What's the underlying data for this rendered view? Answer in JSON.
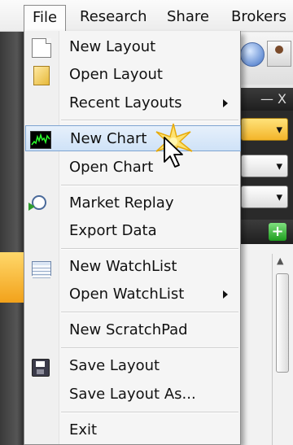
{
  "menubar": {
    "items": [
      "File",
      "Research",
      "Share",
      "Brokers"
    ]
  },
  "background": {
    "title_controls": "— X",
    "dropdown_caret": "▾",
    "add_icon_label": "+"
  },
  "file_menu": {
    "items": [
      {
        "label": "New Layout",
        "icon": "new-page-icon"
      },
      {
        "label": "Open Layout",
        "icon": "folder-icon"
      },
      {
        "label": "Recent Layouts",
        "icon": "",
        "submenu": true
      },
      {
        "label": "New Chart",
        "icon": "chart-icon",
        "highlighted": true
      },
      {
        "label": "Open Chart",
        "icon": ""
      },
      {
        "label": "Market Replay",
        "icon": "replay-icon"
      },
      {
        "label": "Export Data",
        "icon": ""
      },
      {
        "label": "New WatchList",
        "icon": "table-icon"
      },
      {
        "label": "Open WatchList",
        "icon": "",
        "submenu": true
      },
      {
        "label": "New ScratchPad",
        "icon": ""
      },
      {
        "label": "Save Layout",
        "icon": "save-icon"
      },
      {
        "label": "Save Layout As...",
        "icon": ""
      },
      {
        "label": "Exit",
        "icon": ""
      }
    ]
  },
  "colors": {
    "highlight": "#cfe2f7",
    "highlight_border": "#7ea4d1",
    "menu_bg": "#f5f5f5",
    "accent_orange": "#f2a21b"
  }
}
